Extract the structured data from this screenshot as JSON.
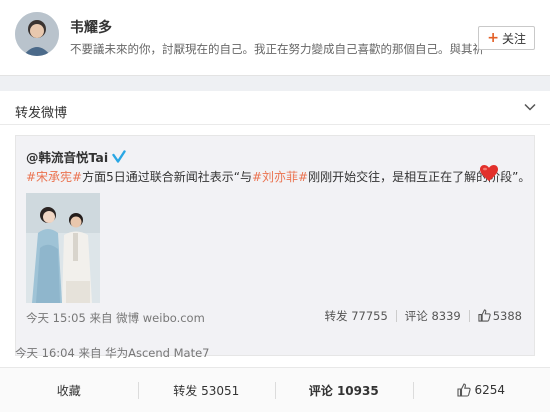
{
  "profile": {
    "name": "韦耀多",
    "bio": "不要議未來的你，討厭現在的自己。我正在努力變成自己喜歡的那個自己。與其祈",
    "follow_label": "关注",
    "follow_plus": "+"
  },
  "card": {
    "title": "转发微博"
  },
  "repost": {
    "author": "@韩流音悦Tai",
    "tag1": "#宋承宪#",
    "text_mid": "方面5日通过联合新闻社表示“与",
    "tag2": "#刘亦菲#",
    "text_end": "刚刚开始交往，是相互正在了解的阶段”。",
    "time": "今天 15:05 来自 微博 weibo.com",
    "repost_count": "转发 77755",
    "comment_count": "评论 8339",
    "like_count": "5388"
  },
  "post": {
    "meta": "今天 16:04 来自 华为Ascend Mate7"
  },
  "actions": {
    "favorite": "收藏",
    "repost": "转发 53051",
    "comment": "评论 10935",
    "like": "6254"
  },
  "colors": {
    "tag": "#eb7350",
    "verified": "#2aa7e4",
    "heart": "#e2302b"
  }
}
